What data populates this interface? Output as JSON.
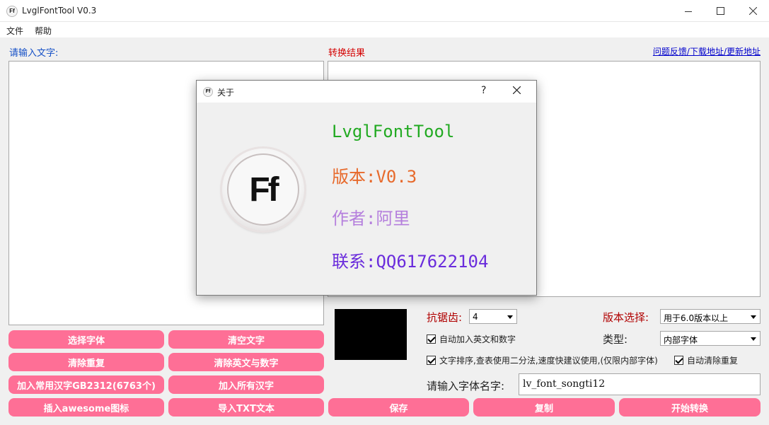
{
  "window": {
    "title": "LvglFontTool V0.3",
    "icon_text": "Ff"
  },
  "menu": [
    "文件",
    "帮助"
  ],
  "left_label": "请输入文字:",
  "right_label": "转换结果",
  "top_link": "问题反馈/下载地址/更新地址",
  "buttons": {
    "select_font": "选择字体",
    "clear_text": "清空文字",
    "remove_duplicates": "清除重复",
    "clear_en_num": "清除英文与数字",
    "add_common": "加入常用汉字GB2312(6763个)",
    "add_all": "加入所有汉字",
    "insert_awesome": "插入awesome图标",
    "import_txt": "导入TXT文本",
    "save": "保存",
    "copy": "复制",
    "start_convert": "开始转换"
  },
  "options": {
    "antialias_label": "抗锯齿:",
    "antialias_value": "4",
    "version_label": "版本选择:",
    "version_value": "用于6.0版本以上",
    "type_label": "类型:",
    "type_value": "内部字体",
    "auto_add_en_num": "自动加入英文和数字",
    "sort_text": "文字排序,查表使用二分法,速度快建议使用,(仅限内部字体)",
    "auto_remove_dup": "自动清除重复",
    "font_name_label": "请输入字体名字:",
    "font_name_value": "lv_font_songti12"
  },
  "dialog": {
    "title": "关于",
    "help": "?",
    "logo_text": "Ff",
    "name": "LvglFontTool",
    "version": "版本:V0.3",
    "author": "作者:阿里",
    "contact": "联系:QQ617622104"
  },
  "colors": {
    "button_pink": "#fe6f96",
    "label_blue": "#1550c7",
    "label_red": "#d40000",
    "link": "#0000cc"
  }
}
